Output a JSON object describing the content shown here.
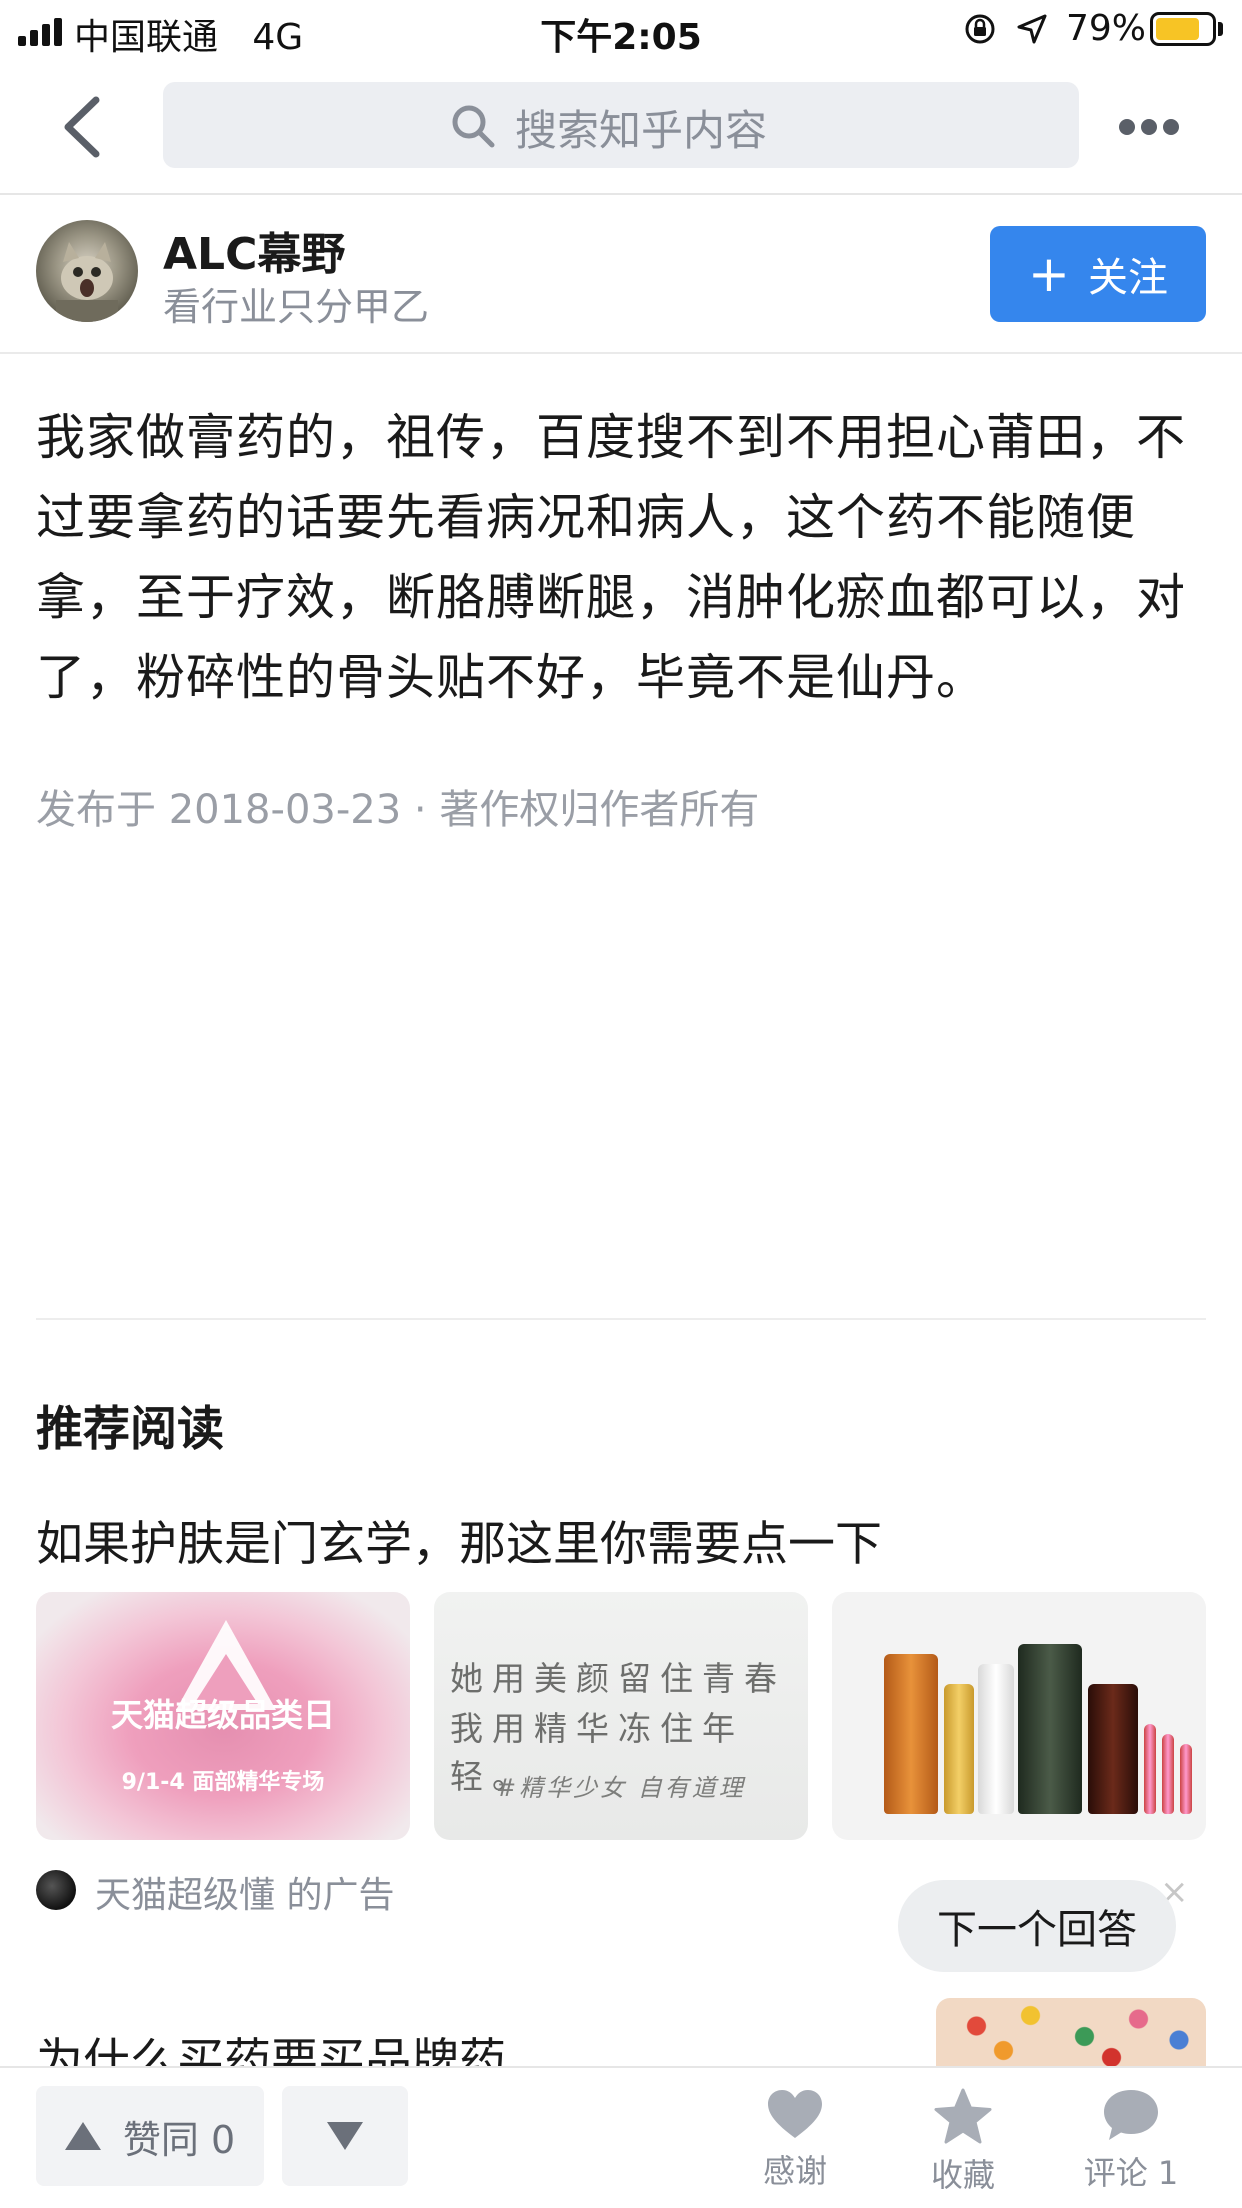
{
  "status_bar": {
    "carrier": "中国联通",
    "network": "4G",
    "time": "下午2:05",
    "battery_percent": "79%",
    "battery_level": 0.79,
    "battery_color": "#f7c425"
  },
  "nav": {
    "search_placeholder": "搜索知乎内容",
    "back_icon": "chevron-left-icon",
    "more_icon": "more-dots-icon"
  },
  "author": {
    "name": "ALC幕野",
    "bio": "看行业只分甲乙",
    "follow_label": "关注",
    "follow_color": "#3586ed"
  },
  "answer": {
    "text": "我家做膏药的，祖传，百度搜不到不用担心莆田，不过要拿药的话要先看病况和病人，这个药不能随便拿，至于疗效，断胳膊断腿，消肿化瘀血都可以，对了，粉碎性的骨头贴不好，毕竟不是仙丹。",
    "published": "发布于 2018-03-23 · 著作权归作者所有"
  },
  "recommend": {
    "heading": "推荐阅读",
    "ad": {
      "title": "如果护肤是门玄学，那这里你需要点一下",
      "image1_line1": "天猫超级品类日",
      "image1_line2": "9/1-4 面部精华专场",
      "image2_line1": "她用美颜留住青春",
      "image2_line2": "我用精华冻住年轻。",
      "image2_line3": "#精华少女 自有道理",
      "source": "天猫超级懂 的广告",
      "close": "×"
    },
    "item2_title": "为什么买药要买品牌药"
  },
  "next_answer_label": "下一个回答",
  "bottom_bar": {
    "upvote_label": "赞同 0",
    "thanks_label": "感谢",
    "collect_label": "收藏",
    "comment_label": "评论 1"
  }
}
